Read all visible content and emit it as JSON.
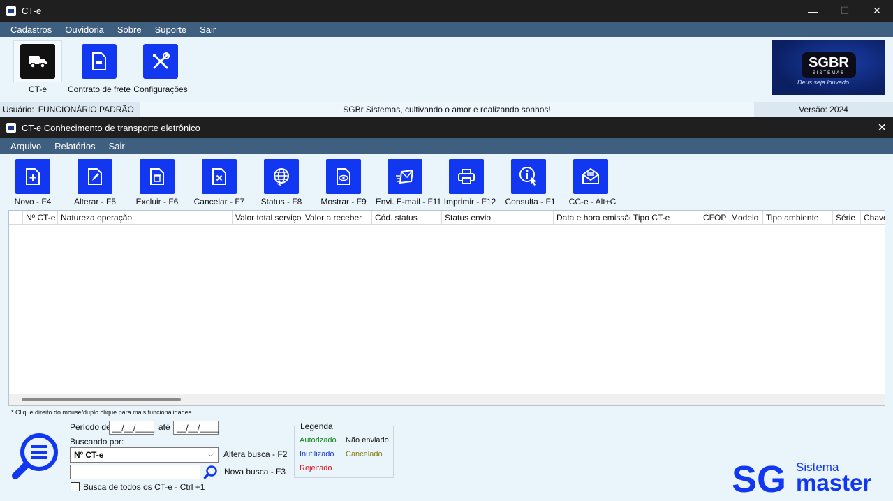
{
  "window": {
    "title": "CT-e",
    "minimize": "—",
    "maximize": "☐",
    "close": "✕"
  },
  "menu": [
    "Cadastros",
    "Ouvidoria",
    "Sobre",
    "Suporte",
    "Sair"
  ],
  "ribbon": {
    "items": [
      {
        "label": "CT-e",
        "icon": "truck-icon"
      },
      {
        "label": "Contrato de frete",
        "icon": "document-icon"
      },
      {
        "label": "Configurações",
        "icon": "tools-icon"
      }
    ]
  },
  "brand": {
    "name": "SGBR",
    "sub": "SISTEMAS",
    "motto": "Deus seja louvado"
  },
  "status": {
    "user_label": "Usuário:",
    "user_value": "FUNCIONÁRIO PADRÃO",
    "motto": "SGBr Sistemas, cultivando o amor e realizando sonhos!",
    "version": "Versão: 2024"
  },
  "inner": {
    "title": "CT-e Conhecimento de transporte eletrônico",
    "close": "✕",
    "menu": [
      "Arquivo",
      "Relatórios",
      "Sair"
    ],
    "toolbar": [
      {
        "label": "Novo - F4",
        "icon": "new-document-icon"
      },
      {
        "label": "Alterar - F5",
        "icon": "edit-icon"
      },
      {
        "label": "Excluir - F6",
        "icon": "delete-icon"
      },
      {
        "label": "Cancelar - F7",
        "icon": "cancel-icon"
      },
      {
        "label": "Status - F8",
        "icon": "globe-icon"
      },
      {
        "label": "Mostrar - F9",
        "icon": "view-icon"
      },
      {
        "label": "Envi. E-mail - F11",
        "icon": "send-mail-icon"
      },
      {
        "label": "Imprimir - F12",
        "icon": "printer-icon"
      },
      {
        "label": "Consulta - F1",
        "icon": "info-icon"
      },
      {
        "label": "CC-e - Alt+C",
        "icon": "mail-open-icon"
      }
    ],
    "columns": [
      "",
      "Nº CT-e",
      "Natureza operação",
      "Valor total serviço",
      "Valor a receber",
      "Cód. status",
      "Status envio",
      "Data e hora emissão",
      "Tipo CT-e",
      "CFOP",
      "Modelo",
      "Tipo ambiente",
      "Série",
      "Chave"
    ],
    "hint": "* Clique direito do mouse/duplo clique para mais funcionalidades",
    "search": {
      "period_label": "Período de",
      "date_from": "__/__/____",
      "until_label": "até",
      "date_to": "__/__/____",
      "search_by_label": "Buscando por:",
      "search_by_value": "Nº CT-e",
      "alter_search": "Altera busca - F2",
      "new_search": "Nova busca - F3",
      "search_value": "",
      "all_checkbox": "Busca de todos os CT-e - Ctrl +1"
    },
    "legend": {
      "title": "Legenda",
      "authorized": "Autorizado",
      "not_sent": "Não enviado",
      "disabled": "Inutilizado",
      "canceled": "Cancelado",
      "rejected": "Rejeitado"
    },
    "brand": {
      "sg": "SG",
      "sistema": "Sistema",
      "master": "master"
    }
  },
  "colors": {
    "accent": "#1237f0",
    "menubar": "#3f5f80",
    "titlebar": "#1f1f1f",
    "authorized": "#1a8a1a",
    "disabled": "#1d3fd0",
    "canceled": "#8a7a10",
    "rejected": "#d81010"
  }
}
